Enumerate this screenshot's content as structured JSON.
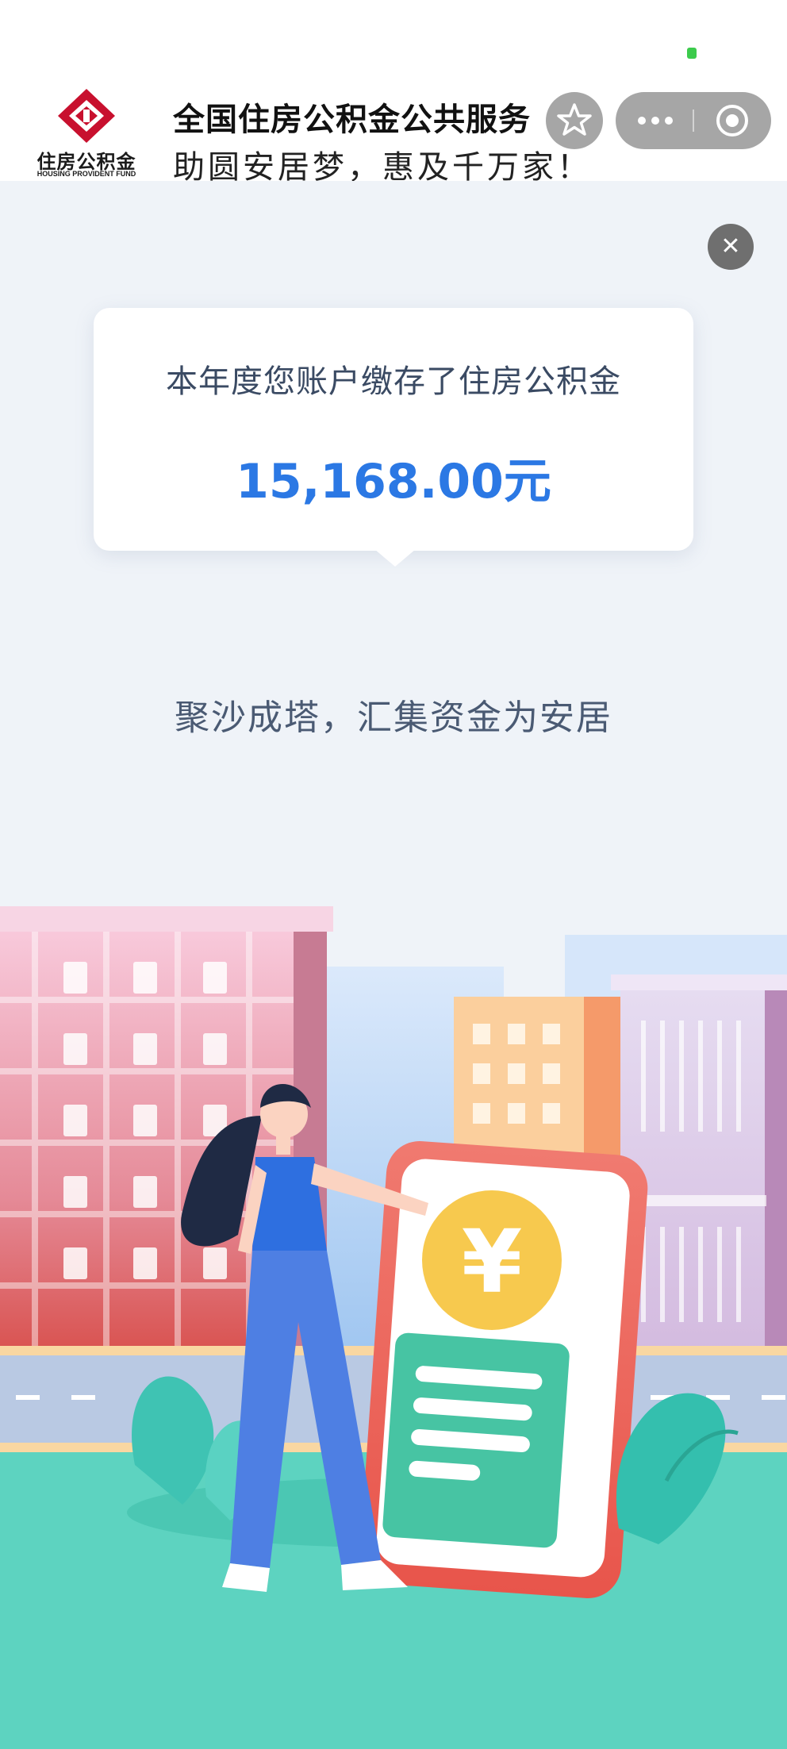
{
  "header": {
    "logo_cn": "住房公积金",
    "logo_en": "HOUSING PROVIDENT FUND",
    "title": "全国住房公积金公共服务",
    "slogan": "助圆安居梦，惠及千万家！"
  },
  "capsule": {
    "favorite_icon": "star-icon",
    "more_icon": "more-dots-icon",
    "exit_icon": "target-circle-icon"
  },
  "popup": {
    "close_icon": "close-icon",
    "label": "本年度您账户缴存了住房公积金",
    "amount": "15,168.00元",
    "slogan": "聚沙成塔，汇集资金为安居"
  },
  "colors": {
    "accent": "#2b78e4",
    "text": "#3a4a63",
    "background": "#eff3f8",
    "logo_red": "#c8102e"
  }
}
